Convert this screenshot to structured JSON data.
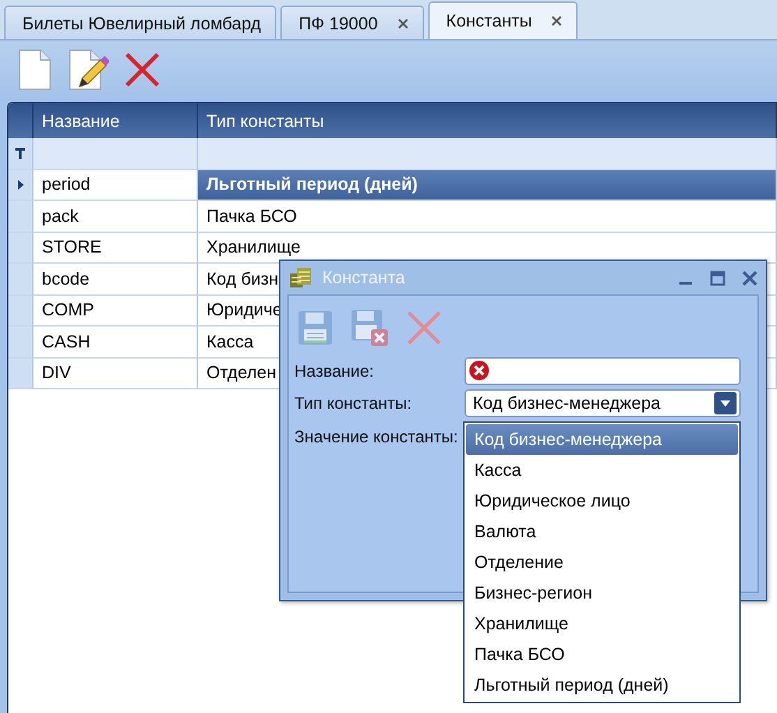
{
  "tabs": [
    {
      "label": "Билеты Ювелирный ломбард",
      "selected": false,
      "closable": false
    },
    {
      "label": "ПФ 19000",
      "selected": false,
      "closable": true
    },
    {
      "label": "Константы",
      "selected": true,
      "closable": true
    }
  ],
  "grid": {
    "columns": [
      "Название",
      "Тип константы"
    ],
    "rows": [
      {
        "name": "period",
        "type": "Льготный период (дней)",
        "selected": true
      },
      {
        "name": "pack",
        "type": "Пачка БСО",
        "selected": false
      },
      {
        "name": "STORE",
        "type": "Хранилище",
        "selected": false
      },
      {
        "name": "bcode",
        "type": "Код бизн",
        "selected": false
      },
      {
        "name": "COMP",
        "type": "Юридиче",
        "selected": false
      },
      {
        "name": "CASH",
        "type": "Касса",
        "selected": false
      },
      {
        "name": "DIV",
        "type": "Отделен",
        "selected": false
      }
    ]
  },
  "dialog": {
    "title": "Константа",
    "fields": [
      {
        "kind": "text",
        "label": "Название:",
        "error": true
      },
      {
        "kind": "combo",
        "label": "Тип константы:",
        "value": "Код бизнес-менеджера"
      },
      {
        "kind": "none",
        "label": "Значение константы:"
      }
    ],
    "dropdown": [
      {
        "label": "Код бизнес-менеджера",
        "selected": true
      },
      {
        "label": "Касса",
        "selected": false
      },
      {
        "label": "Юридическое лицо",
        "selected": false
      },
      {
        "label": "Валюта",
        "selected": false
      },
      {
        "label": "Отделение",
        "selected": false
      },
      {
        "label": "Бизнес-регион",
        "selected": false
      },
      {
        "label": "Хранилище",
        "selected": false
      },
      {
        "label": "Пачка БСО",
        "selected": false
      },
      {
        "label": "Льготный период (дней)",
        "selected": false
      }
    ]
  }
}
